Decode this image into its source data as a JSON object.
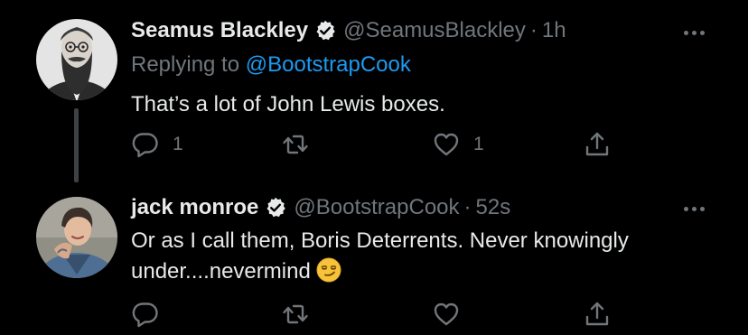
{
  "tweets": [
    {
      "display_name": "Seamus Blackley",
      "handle": "@SeamusBlackley",
      "separator": "·",
      "time": "1h",
      "replying_prefix": "Replying to",
      "replying_handle": "@BootstrapCook",
      "text": "That’s a lot of John Lewis boxes.",
      "reply_count": "1",
      "retweet_count": "",
      "like_count": "1",
      "avatar_icon": "bearded-man-portrait"
    },
    {
      "display_name": "jack monroe",
      "handle": "@BootstrapCook",
      "separator": "·",
      "time": "52s",
      "text": "Or as I call them, Boris Deterrents. Never knowingly under....nevermind",
      "emoji": "smirking-face",
      "reply_count": "",
      "retweet_count": "",
      "like_count": "",
      "avatar_icon": "person-denim-jacket-portrait"
    }
  ],
  "colors": {
    "background": "#000000",
    "primary_text": "#e7e9ea",
    "secondary_text": "#71767b",
    "link": "#1d9bf0",
    "thread_line": "#3d4145"
  }
}
